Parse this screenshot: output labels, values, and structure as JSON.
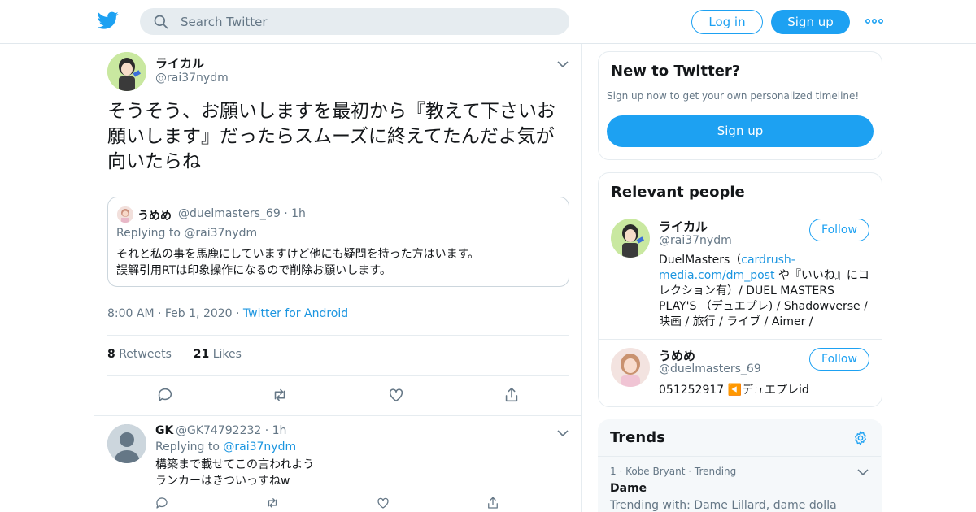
{
  "header": {
    "search_placeholder": "Search Twitter",
    "login_label": "Log in",
    "signup_label": "Sign up",
    "brand_color": "#1da1f2"
  },
  "tweet": {
    "name": "ライカル",
    "handle": "@rai37nydm",
    "text": "そうそう、お願いしますを最初から『教えて下さいお願いします』だったらスムーズに終えてたんだよ気が向いたらね",
    "quote": {
      "name": "うめめ",
      "meta": "@duelmasters_69 · 1h",
      "replying": "Replying to @rai37nydm",
      "text_line1": "それと私の事を馬鹿にしていますけど他にも疑問を持った方はいます。",
      "text_line2": "誤解引用RTは印象操作になるので削除お願いします。"
    },
    "time": "8:00 AM · Feb 1, 2020 · ",
    "source": "Twitter for Android",
    "retweets_count": "8",
    "retweets_label": "Retweets",
    "likes_count": "21",
    "likes_label": "Likes"
  },
  "reply": {
    "name": "GK",
    "meta": "@GK74792232 · 1h",
    "replying_prefix": "Replying to ",
    "replying_handle": "@rai37nydm",
    "text_line1": "構築まで載せてこの言われよう",
    "text_line2": "ランカーはきついっすねw"
  },
  "sidebar": {
    "new_title": "New to Twitter?",
    "new_sub": "Sign up now to get your own personalized timeline!",
    "new_signup": "Sign up",
    "people_title": "Relevant people",
    "people": [
      {
        "name": "ライカル",
        "handle": "@rai37nydm",
        "follow": "Follow",
        "bio_prefix": "DuelMasters（",
        "bio_link": "cardrush-media.com/dm_post",
        "bio_suffix": " や『いいね』にコレクション有）/ DUEL MASTERS PLAY'S （デュエプレ) / Shadowverse / 映画 / 旅行 / ライブ / Aimer /"
      },
      {
        "name": "うめめ",
        "handle": "@duelmasters_69",
        "follow": "Follow",
        "bio": "051252917 ◀️デュエプレid"
      }
    ],
    "trends_title": "Trends",
    "trend": {
      "meta": "1 · Kobe Bryant · Trending",
      "name": "Dame",
      "with": "Trending with: Dame Lillard, dame dolla"
    }
  }
}
